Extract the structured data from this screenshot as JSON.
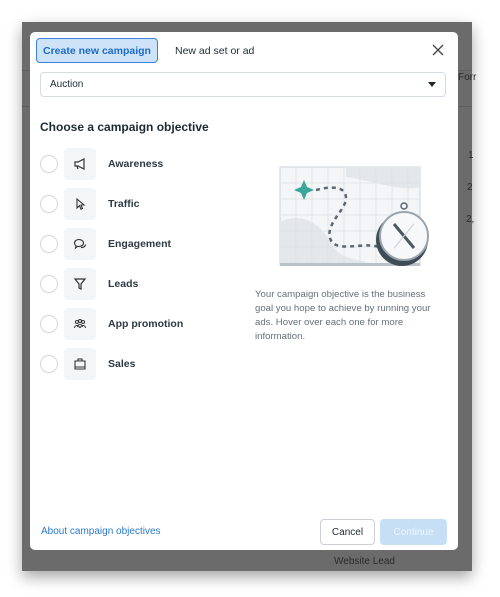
{
  "background": {
    "fragments": [
      "Forr",
      "1",
      "2",
      "2,",
      "Website Lead"
    ]
  },
  "tabs": [
    {
      "label": "Create new campaign",
      "active": true
    },
    {
      "label": "New ad set or ad",
      "active": false
    }
  ],
  "buying_type": {
    "selected": "Auction"
  },
  "objective": {
    "heading": "Choose a campaign objective",
    "options": [
      {
        "label": "Awareness",
        "icon": "megaphone-icon",
        "selected": false
      },
      {
        "label": "Traffic",
        "icon": "cursor-icon",
        "selected": false
      },
      {
        "label": "Engagement",
        "icon": "chat-bubbles-icon",
        "selected": false
      },
      {
        "label": "Leads",
        "icon": "funnel-icon",
        "selected": false
      },
      {
        "label": "App promotion",
        "icon": "people-icon",
        "selected": false
      },
      {
        "label": "Sales",
        "icon": "shopping-bag-icon",
        "selected": false
      }
    ],
    "help_text": "Your campaign objective is the business goal you hope to achieve by running your ads. Hover over each one for more information."
  },
  "footer": {
    "about_link": "About campaign objectives",
    "cancel_label": "Cancel",
    "continue_label": "Continue",
    "continue_disabled": true
  },
  "colors": {
    "accent": "#1d6cc6",
    "tab_active_bg": "#cfe3f8",
    "illustration_star": "#3aa79a"
  }
}
